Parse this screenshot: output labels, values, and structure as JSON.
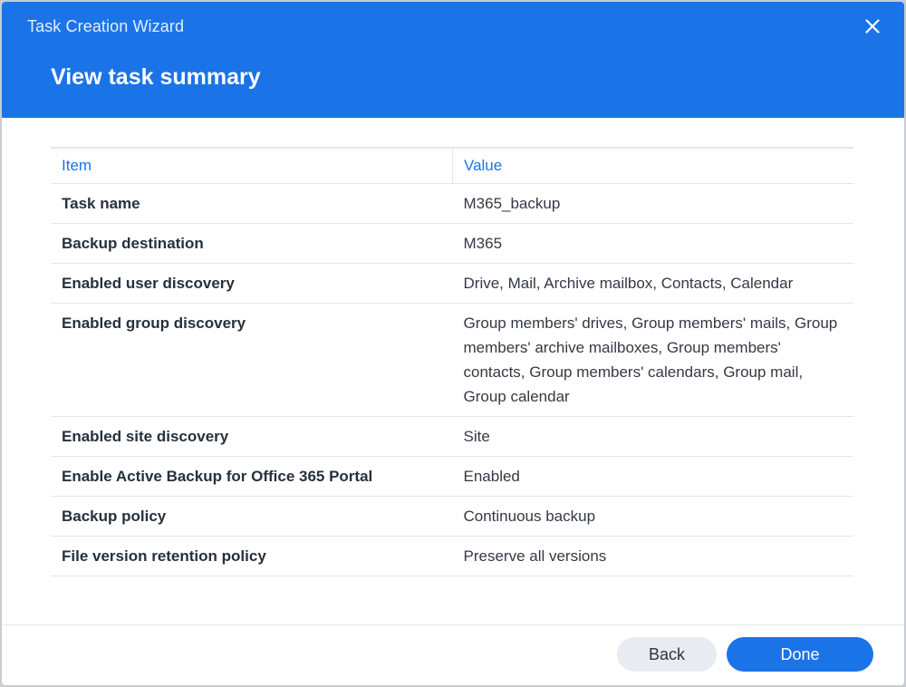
{
  "window": {
    "title": "Task Creation Wizard",
    "close_icon": "close-icon"
  },
  "page": {
    "title": "View task summary"
  },
  "table": {
    "headers": [
      "Item",
      "Value"
    ],
    "rows": [
      {
        "item": "Task name",
        "value": "M365_backup"
      },
      {
        "item": "Backup destination",
        "value": "M365"
      },
      {
        "item": "Enabled user discovery",
        "value": "Drive, Mail, Archive mailbox, Contacts, Calendar"
      },
      {
        "item": "Enabled group discovery",
        "value": "Group members' drives, Group members' mails, Group members' archive mailboxes, Group members' contacts, Group members' calendars, Group mail, Group calendar"
      },
      {
        "item": "Enabled site discovery",
        "value": "Site"
      },
      {
        "item": "Enable Active Backup for Office 365 Portal",
        "value": "Enabled"
      },
      {
        "item": "Backup policy",
        "value": "Continuous backup"
      },
      {
        "item": "File version retention policy",
        "value": "Preserve all versions"
      }
    ]
  },
  "footer": {
    "back_label": "Back",
    "done_label": "Done"
  },
  "colors": {
    "accent": "#1b73e8",
    "secondary_button": "#e8ecf2",
    "divider": "#e3e6ea"
  }
}
